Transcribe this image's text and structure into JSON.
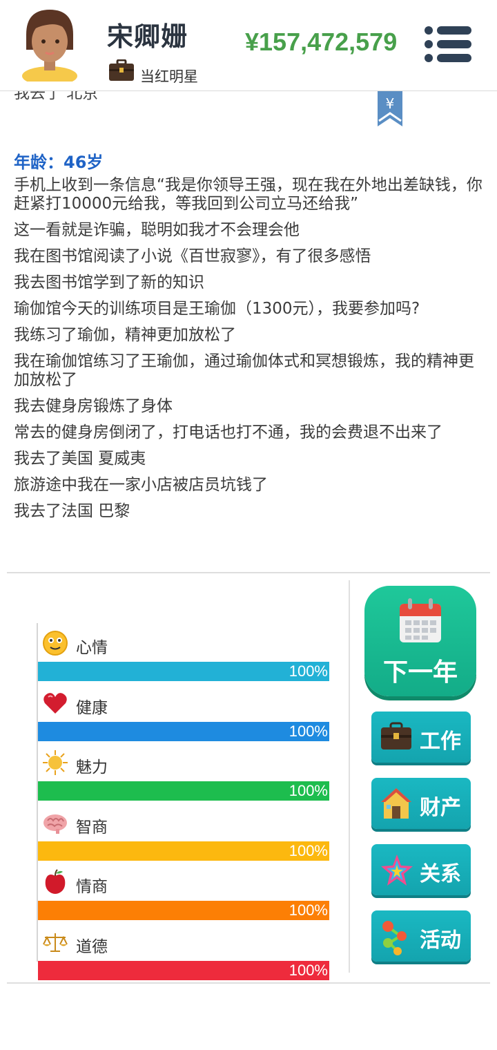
{
  "player": {
    "name": "宋卿姗",
    "job": "当红明星",
    "money": "¥157,472,579"
  },
  "log": {
    "cut_line": "我去了 北京",
    "age": "年龄：46岁",
    "entries": [
      "手机上收到一条信息“我是你领导王强，现在我在外地出差缺钱，你赶紧打10000元给我，等我回到公司立马还给我”",
      "这一看就是诈骗，聪明如我才不会理会他",
      "我在图书馆阅读了小说《百世寂寥》，有了很多感悟",
      "我去图书馆学到了新的知识",
      "瑜伽馆今天的训练项目是王瑜伽（1300元），我要参加吗?",
      "我练习了瑜伽，精神更加放松了",
      "我在瑜伽馆练习了王瑜伽，通过瑜伽体式和冥想锻炼，我的精神更加放松了",
      "我去健身房锻炼了身体",
      "常去的健身房倒闭了，打电话也打不通，我的会费退不出来了",
      "我去了美国 夏威夷",
      "旅游途中我在一家小店被店员坑钱了",
      "我去了法国 巴黎"
    ]
  },
  "stats": [
    {
      "label": "心情",
      "value": "100%",
      "level": 1.0,
      "color": "#22b1d6",
      "icon": "smiley-icon"
    },
    {
      "label": "健康",
      "value": "100%",
      "level": 1.0,
      "color": "#1e8be0",
      "icon": "heart-icon"
    },
    {
      "label": "魅力",
      "value": "100%",
      "level": 1.0,
      "color": "#1dbd4e",
      "icon": "sun-icon"
    },
    {
      "label": "智商",
      "value": "100%",
      "level": 1.0,
      "color": "#fcb80f",
      "icon": "brain-icon"
    },
    {
      "label": "情商",
      "value": "100%",
      "level": 1.0,
      "color": "#fc7f05",
      "icon": "apple-icon"
    },
    {
      "label": "道德",
      "value": "100%",
      "level": 1.0,
      "color": "#ee2b3c",
      "icon": "scales-icon"
    }
  ],
  "actions": {
    "next_year": "下一年",
    "work": "工作",
    "property": "财产",
    "relations": "关系",
    "activities": "活动"
  }
}
